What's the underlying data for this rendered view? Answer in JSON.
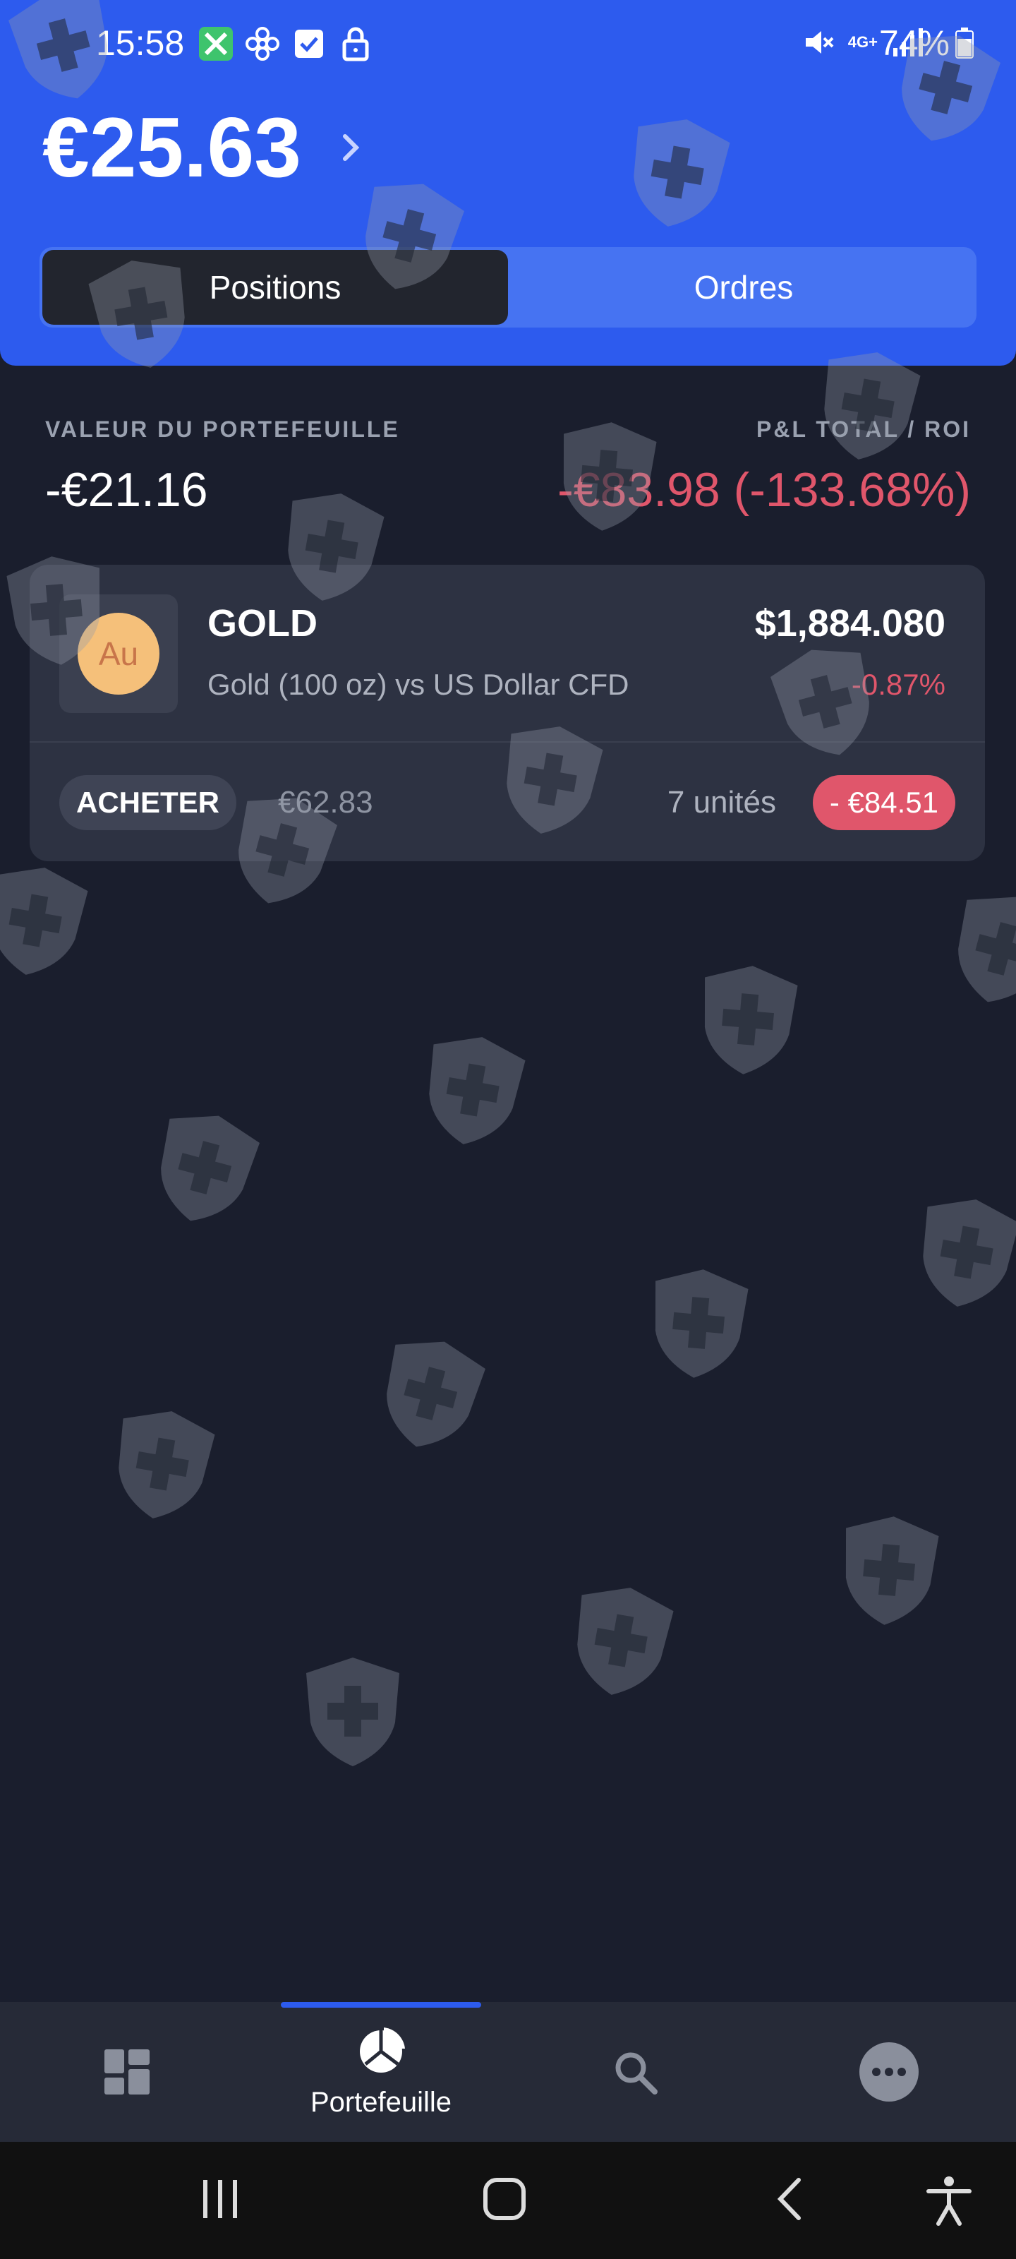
{
  "status_bar": {
    "time": "15:58",
    "battery": "74%",
    "network": "4G+"
  },
  "header": {
    "balance": "€25.63",
    "tabs": [
      {
        "label": "Positions",
        "active": true
      },
      {
        "label": "Ordres",
        "active": false
      }
    ]
  },
  "summary": {
    "portfolio_label": "VALEUR DU PORTEFEUILLE",
    "portfolio_value": "-€21.16",
    "pnl_label": "P&L TOTAL / ROI",
    "pnl_value": "-€83.98 (-133.68%)"
  },
  "position": {
    "icon_text": "Au",
    "symbol": "GOLD",
    "name": "Gold (100 oz) vs US Dollar CFD",
    "price": "$1,884.080",
    "change": "-0.87%",
    "action": "ACHETER",
    "invested": "€62.83",
    "units": "7 unités",
    "pnl": "- €84.51"
  },
  "bottom_nav": {
    "items": [
      {
        "icon": "dashboard-icon",
        "label": ""
      },
      {
        "icon": "pie-chart-icon",
        "label": "Portefeuille",
        "active": true
      },
      {
        "icon": "search-icon",
        "label": ""
      },
      {
        "icon": "more-icon",
        "label": ""
      }
    ]
  },
  "colors": {
    "accent": "#2d5bee",
    "background": "#1a1e2d",
    "negative": "#e0566b"
  }
}
